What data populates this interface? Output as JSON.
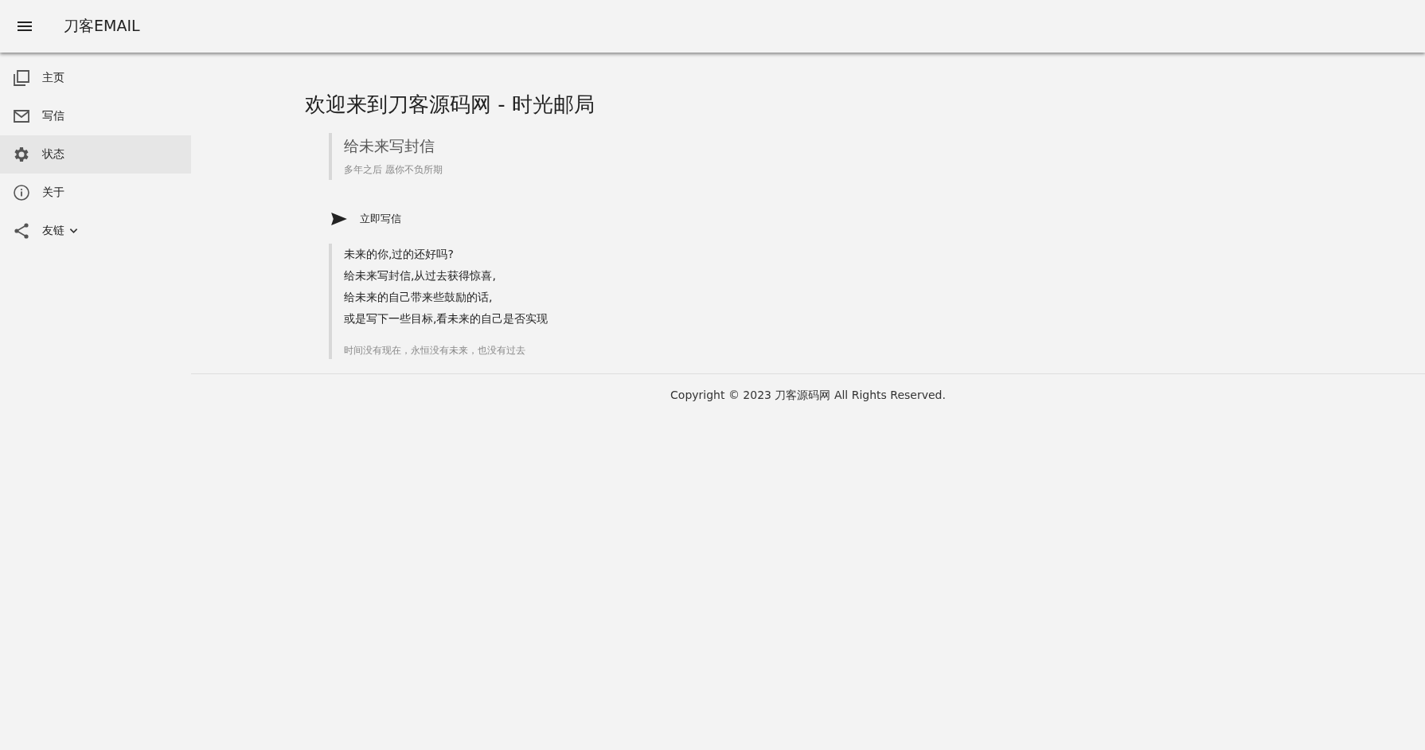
{
  "header": {
    "title": "刀客EMAIL"
  },
  "sidebar": {
    "items": [
      {
        "label": "主页",
        "kind": "home",
        "selected": false
      },
      {
        "label": "写信",
        "kind": "mail",
        "selected": false
      },
      {
        "label": "状态",
        "kind": "settings",
        "selected": true
      },
      {
        "label": "关于",
        "kind": "info",
        "selected": false
      },
      {
        "label": "友链",
        "kind": "share",
        "selected": false,
        "expanded": false
      }
    ]
  },
  "main": {
    "title": "欢迎来到刀客源码网 - 时光邮局",
    "intro": {
      "heading": "给未来写封信",
      "subheading": "多年之后 愿你不负所期"
    },
    "action": {
      "label": "立即写信"
    },
    "quote": {
      "lines": [
        "未来的你,过的还好吗?",
        "给未来写封信,从过去获得惊喜,",
        "给未来的自己带来些鼓励的话,",
        "或是写下一些目标,看未来的自己是否实现"
      ],
      "footnote": "时间没有现在，永恒没有未来，也没有过去"
    }
  },
  "footer": {
    "copyright": "Copyright © 2023 刀客源码网 All Rights Reserved."
  }
}
